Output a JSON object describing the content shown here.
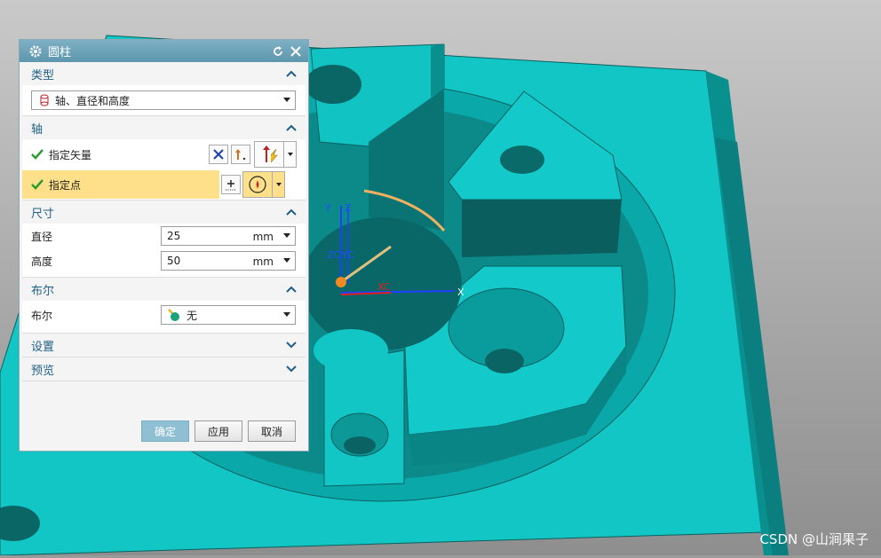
{
  "dialog": {
    "title": "圆柱",
    "sections": {
      "type": {
        "title": "类型",
        "selected": "轴、直径和高度"
      },
      "axis": {
        "title": "轴",
        "vector_label": "指定矢量",
        "point_label": "指定点"
      },
      "dimensions": {
        "title": "尺寸",
        "diameter_label": "直径",
        "diameter_value": "25",
        "diameter_unit": "mm",
        "height_label": "高度",
        "height_value": "50",
        "height_unit": "mm"
      },
      "boolean": {
        "title": "布尔",
        "label": "布尔",
        "value": "无"
      },
      "settings": {
        "title": "设置"
      },
      "preview": {
        "title": "预览"
      }
    },
    "buttons": {
      "ok": "确定",
      "apply": "应用",
      "cancel": "取消"
    },
    "colors": {
      "title_bar": "#6aa3b9",
      "section_title": "#1f5f86",
      "highlight": "#ffe08a",
      "check": "#2f9a2f"
    }
  },
  "viewport": {
    "csys_labels": {
      "y": "Y",
      "z": "Z",
      "zc": "ZC",
      "yc": "YC",
      "xc": "XC",
      "x": "X"
    },
    "part_color": "#14c8c8",
    "background_color": "#a3a3a3"
  },
  "watermark": "CSDN @山涧果子"
}
